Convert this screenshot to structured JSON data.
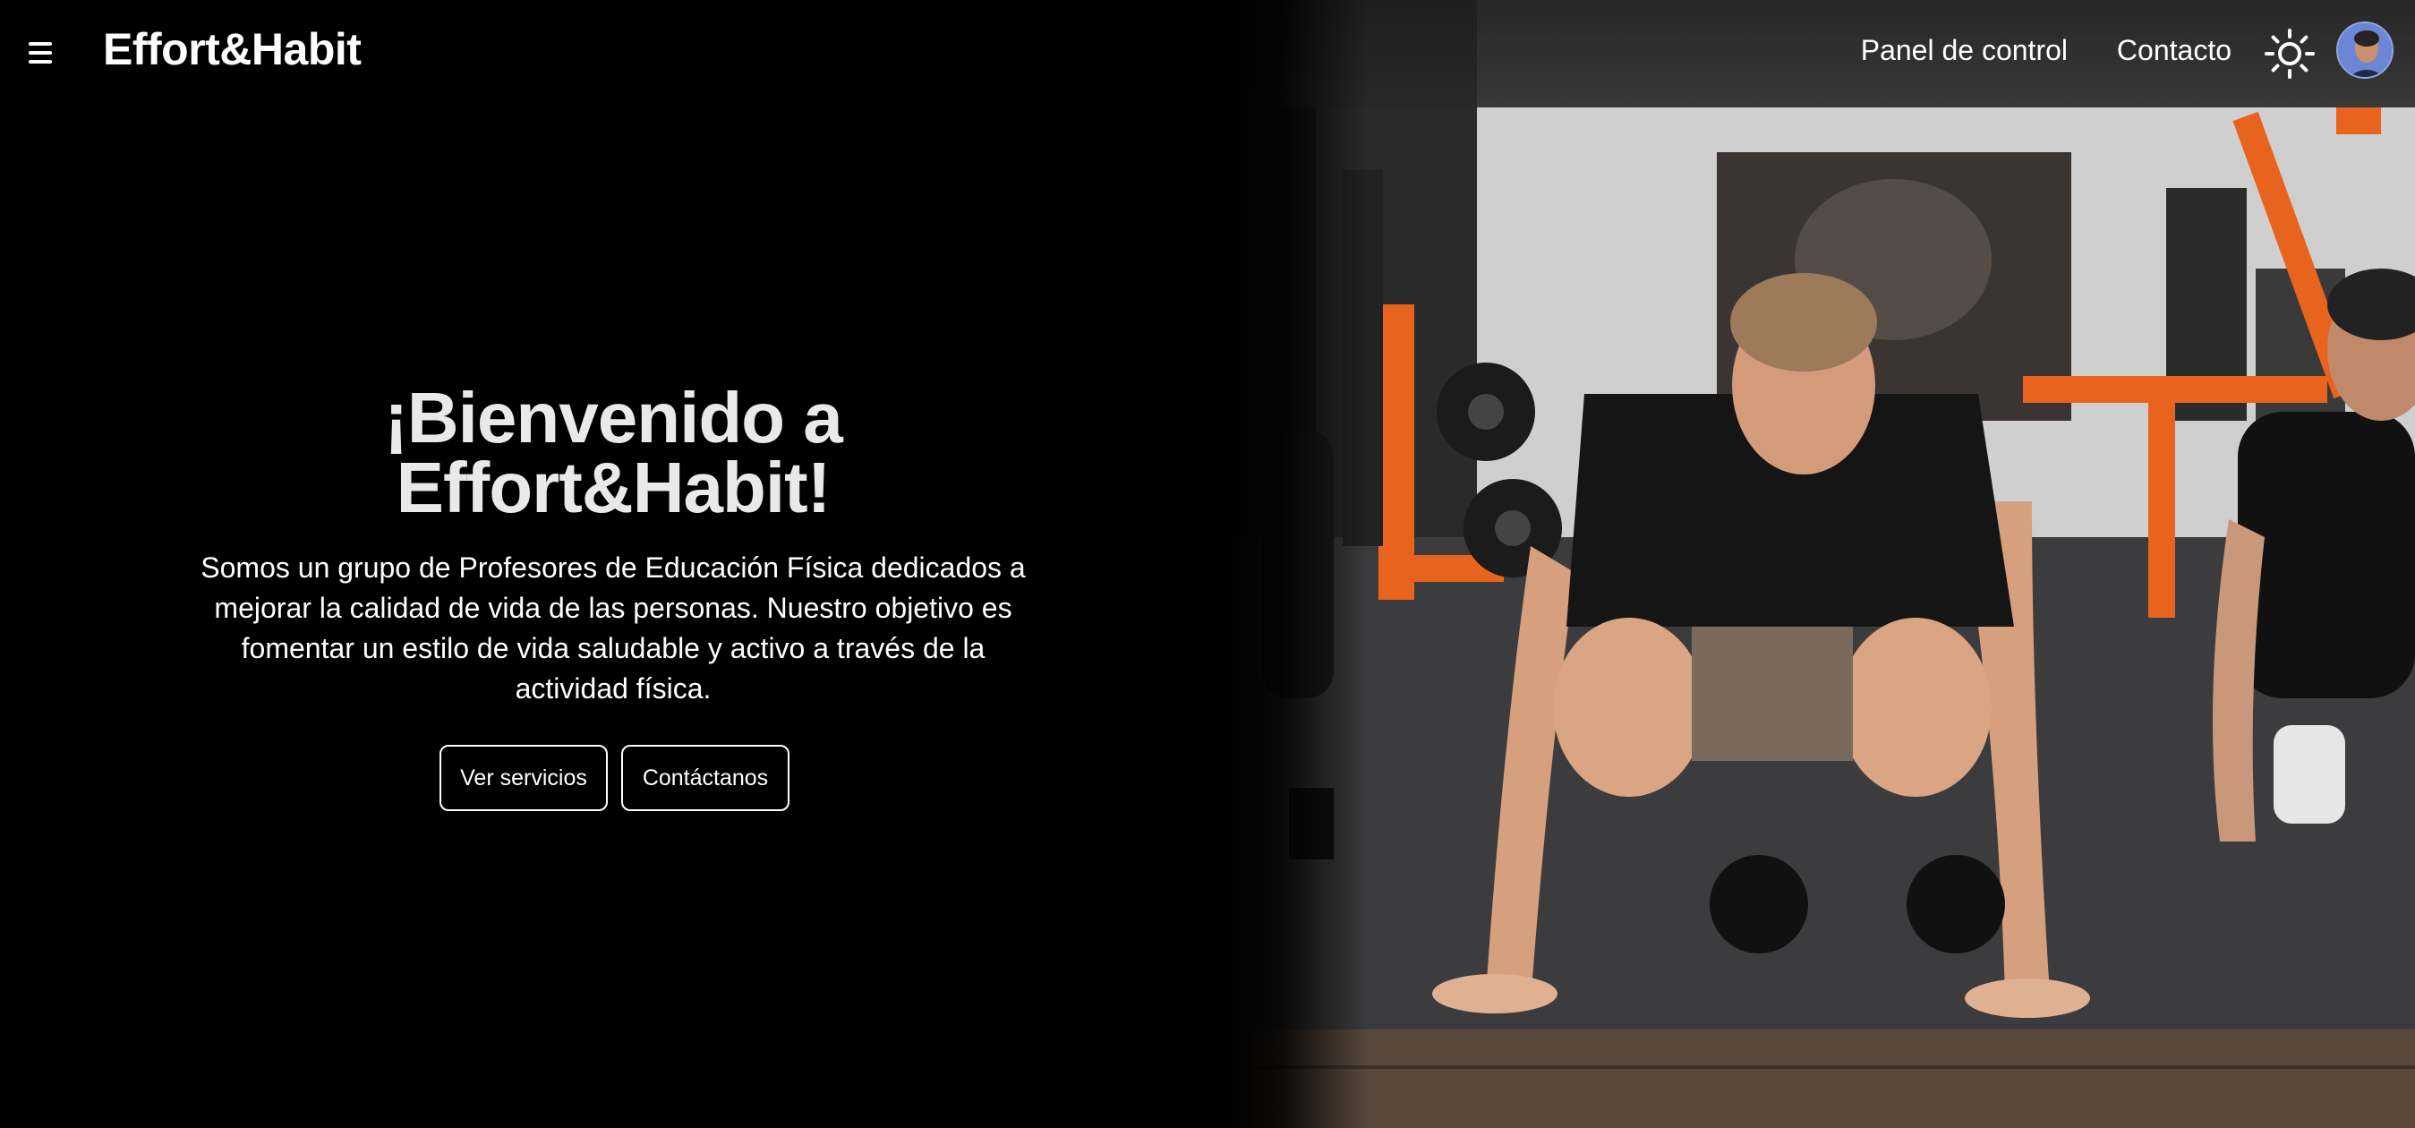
{
  "header": {
    "menu_icon": "hamburger-menu-icon",
    "brand": "Effort&Habit",
    "nav": [
      {
        "label": "Panel de control"
      },
      {
        "label": "Contacto"
      }
    ],
    "theme_icon": "sun-icon",
    "avatar_icon": "user-avatar"
  },
  "hero": {
    "title_line1": "¡Bienvenido a",
    "title_line2": "Effort&Habit!",
    "description": "Somos un grupo de Profesores de Educación Física dedicados a mejorar la calidad de vida de las personas. Nuestro objetivo es fomentar un estilo de vida saludable y activo a través de la actividad física.",
    "buttons": [
      {
        "label": "Ver servicios"
      },
      {
        "label": "Contáctanos"
      }
    ]
  },
  "colors": {
    "background": "#000000",
    "text": "#ffffff",
    "accent_orange": "#e8641e"
  }
}
